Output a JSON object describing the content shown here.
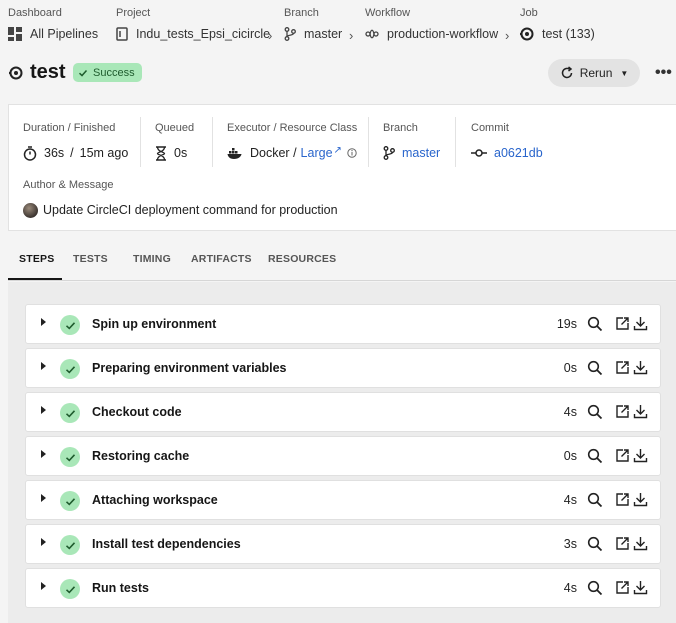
{
  "breadcrumbs": [
    {
      "label": "Dashboard",
      "value": "All Pipelines",
      "icon": "dashboard-icon"
    },
    {
      "label": "Project",
      "value": "Indu_tests_Epsi_cicircle",
      "icon": "project-icon"
    },
    {
      "label": "Branch",
      "value": "master",
      "icon": "branch-icon"
    },
    {
      "label": "Workflow",
      "value": "production-workflow",
      "icon": "workflow-icon"
    },
    {
      "label": "Job",
      "value": "test (133)",
      "icon": "job-icon"
    }
  ],
  "job": {
    "title": "test",
    "status": "Success",
    "rerun_label": "Rerun",
    "more_label": "•••"
  },
  "details": {
    "duration_label": "Duration / Finished",
    "duration": "36s",
    "duration_sep": "/",
    "finished": "15m ago",
    "queued_label": "Queued",
    "queued": "0s",
    "executor_label": "Executor / Resource Class",
    "executor": "Docker /",
    "resource_class": "Large",
    "branch_label": "Branch",
    "branch": "master",
    "commit_label": "Commit",
    "commit": "a0621db",
    "author_label": "Author & Message",
    "message": "Update CircleCI deployment command for production"
  },
  "tabs": [
    "STEPS",
    "TESTS",
    "TIMING",
    "ARTIFACTS",
    "RESOURCES"
  ],
  "steps": [
    {
      "name": "Spin up environment",
      "duration": "19s"
    },
    {
      "name": "Preparing environment variables",
      "duration": "0s"
    },
    {
      "name": "Checkout code",
      "duration": "4s"
    },
    {
      "name": "Restoring cache",
      "duration": "0s"
    },
    {
      "name": "Attaching workspace",
      "duration": "4s"
    },
    {
      "name": "Install test dependencies",
      "duration": "3s"
    },
    {
      "name": "Run tests",
      "duration": "4s"
    }
  ],
  "colors": {
    "success_bg": "#a9e7b8",
    "success_fg": "#1f5c2e",
    "link": "#2965cc"
  }
}
